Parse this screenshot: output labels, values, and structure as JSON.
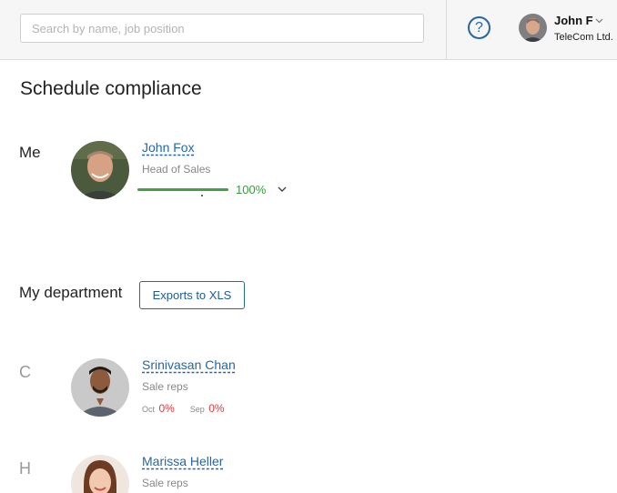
{
  "header": {
    "search_placeholder": "Search by name, job position",
    "help_glyph": "?",
    "user": {
      "name": "John F",
      "company": "TeleCom Ltd."
    }
  },
  "page": {
    "title": "Schedule compliance"
  },
  "me": {
    "label": "Me",
    "name": "John Fox",
    "role": "Head of Sales",
    "progress": 1.0,
    "progress_text": "100%"
  },
  "department": {
    "label": "My department",
    "export_label": "Exports to XLS",
    "groups": [
      {
        "letter": "C",
        "name": "Srinivasan Chan",
        "role": "Sale reps",
        "months": [
          {
            "label": "Oct",
            "value": "0%"
          },
          {
            "label": "Sep",
            "value": "0%"
          }
        ]
      },
      {
        "letter": "H",
        "name": "Marissa Heller",
        "role": "Sale reps"
      }
    ]
  },
  "colors": {
    "accent": "#2467a8",
    "success": "#3a9a3e",
    "danger": "#e0393e"
  }
}
